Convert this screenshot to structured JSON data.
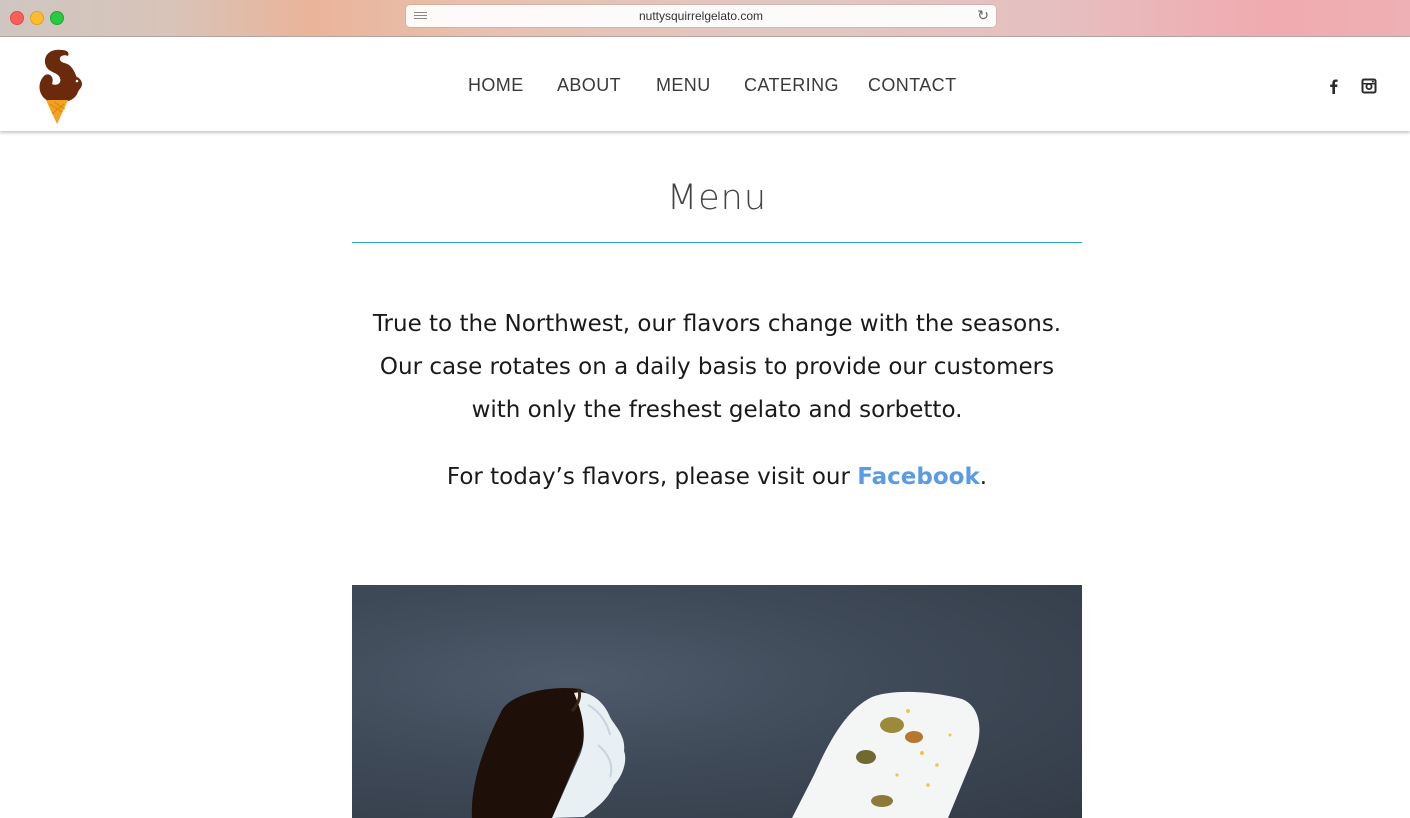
{
  "browser": {
    "url": "nuttysquirrelgelato.com"
  },
  "header": {
    "logo_name": "squirrel-cone-logo",
    "nav": [
      {
        "label": "HOME"
      },
      {
        "label": "ABOUT"
      },
      {
        "label": "MENU"
      },
      {
        "label": "CATERING"
      },
      {
        "label": "CONTACT"
      }
    ],
    "social": [
      {
        "icon": "facebook-icon"
      },
      {
        "icon": "instagram-icon"
      }
    ]
  },
  "main": {
    "title": "Menu",
    "intro": "True to the Northwest, our flavors change with the seasons. Our case rotates on a daily basis to provide our customers with only the freshest gelato and sorbetto.",
    "flavors_prefix": "For today’s flavors, please visit our ",
    "flavors_link": "Facebook",
    "flavors_suffix": "."
  },
  "colors": {
    "accent_rule": "#2aa4c8",
    "link": "#5b9be6",
    "logo_brown": "#6b2a0c",
    "logo_cone": "#f4a11f"
  }
}
